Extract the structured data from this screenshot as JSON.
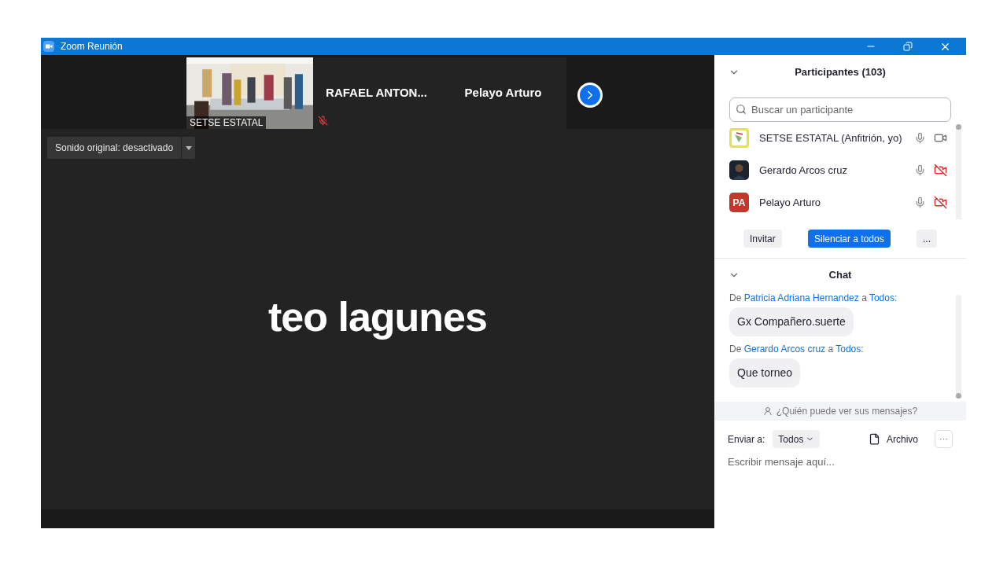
{
  "window": {
    "title": "Zoom Reunión"
  },
  "tiles": [
    {
      "kind": "video",
      "name": "SETSE ESTATAL",
      "muted": false
    },
    {
      "kind": "name",
      "name": "RAFAEL  ANTON...",
      "muted": true
    },
    {
      "kind": "name",
      "name": "Pelayo Arturo",
      "muted": false
    }
  ],
  "audio_button": {
    "label": "Sonido original: desactivado"
  },
  "speaker": {
    "name": "teo lagunes"
  },
  "participants": {
    "title": "Participantes (103)",
    "search": {
      "placeholder": "Buscar un participante"
    },
    "items": [
      {
        "kind": "logo",
        "name": "SETSE ESTATAL (Anfitrión, yo)",
        "video": true
      },
      {
        "name": "Gerardo Arcos cruz",
        "video": false
      },
      {
        "kind": "initials",
        "initials": "PA",
        "color": "#c0392b",
        "name": "Pelayo Arturo",
        "video": false
      }
    ],
    "buttons": [
      {
        "label": "Invitar",
        "primary": false
      },
      {
        "label": "Silenciar a todos",
        "primary": true
      },
      {
        "label": "...",
        "primary": false
      }
    ]
  },
  "chat": {
    "title": "Chat",
    "messages": [
      {
        "prefix": "De",
        "sender": "Patricia Adriana Hernandez",
        "joiner": "a",
        "recipient": "Todos:",
        "text": "Gx Compañero.suerte"
      },
      {
        "prefix": "De",
        "sender": "Gerardo Arcos cruz",
        "joiner": "a",
        "recipient": "Todos:",
        "text": "Que torneo"
      }
    ],
    "privacy_note": "¿Quién puede ver sus mensajes?",
    "send_to_label": "Enviar a:",
    "send_to": "Todos",
    "file_button": "Archivo",
    "more": "···",
    "input": {
      "placeholder": "Escribir mensaje aquí..."
    }
  }
}
